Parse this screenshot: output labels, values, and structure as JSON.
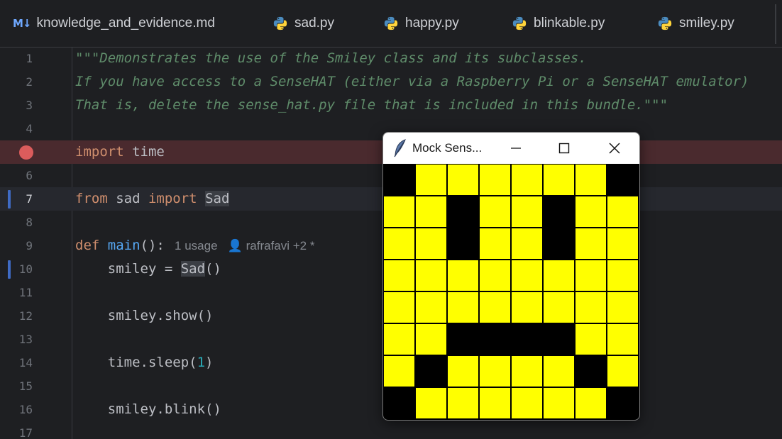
{
  "tabs": [
    {
      "label": "knowledge_and_evidence.md",
      "type": "md",
      "icon": "markdown-icon",
      "icon_text": "M↓"
    },
    {
      "label": "sad.py",
      "type": "py",
      "icon": "python-icon"
    },
    {
      "label": "happy.py",
      "type": "py",
      "icon": "python-icon"
    },
    {
      "label": "blinkable.py",
      "type": "py",
      "icon": "python-icon"
    },
    {
      "label": "smiley.py",
      "type": "py",
      "icon": "python-icon"
    }
  ],
  "editor": {
    "lines": [
      {
        "n": "1",
        "tokens": [
          {
            "t": "\"\"\"Demonstrates the use of the Smiley class and its subclasses.",
            "c": "doc"
          }
        ]
      },
      {
        "n": "2",
        "tokens": [
          {
            "t": "If you have access to a SenseHAT (either via a Raspberry Pi or a SenseHAT emulator)",
            "c": "doc"
          }
        ]
      },
      {
        "n": "3",
        "tokens": [
          {
            "t": "That is, delete the sense_hat.py file that is included in this bundle.\"\"\"",
            "c": "doc"
          }
        ]
      },
      {
        "n": "4",
        "tokens": []
      },
      {
        "n": "",
        "breakpoint": true,
        "tokens": [
          {
            "t": "import",
            "c": "kw"
          },
          {
            "t": " time",
            "c": ""
          }
        ]
      },
      {
        "n": "6",
        "tokens": []
      },
      {
        "n": "7",
        "active": true,
        "changed": true,
        "tokens": [
          {
            "t": "from",
            "c": "kw"
          },
          {
            "t": " sad ",
            "c": ""
          },
          {
            "t": "import",
            "c": "kw"
          },
          {
            "t": " ",
            "c": ""
          },
          {
            "t": "Sad",
            "c": "ref-hl"
          }
        ]
      },
      {
        "n": "8",
        "tokens": []
      },
      {
        "n": "9",
        "tokens": [
          {
            "t": "def",
            "c": "kw"
          },
          {
            "t": " ",
            "c": ""
          },
          {
            "t": "main",
            "c": "fn"
          },
          {
            "t": "():",
            "c": ""
          },
          {
            "t": "   1 usage   👤 rafrafavi +2 *",
            "c": "hint"
          }
        ]
      },
      {
        "n": "10",
        "changed": true,
        "tokens": [
          {
            "t": "    smiley = ",
            "c": ""
          },
          {
            "t": "Sad",
            "c": "ref-hl"
          },
          {
            "t": "()",
            "c": ""
          }
        ]
      },
      {
        "n": "11",
        "tokens": []
      },
      {
        "n": "12",
        "tokens": [
          {
            "t": "    smiley.show()",
            "c": ""
          }
        ]
      },
      {
        "n": "13",
        "tokens": []
      },
      {
        "n": "14",
        "tokens": [
          {
            "t": "    time.sleep(",
            "c": ""
          },
          {
            "t": "1",
            "c": "num"
          },
          {
            "t": ")",
            "c": ""
          }
        ]
      },
      {
        "n": "15",
        "tokens": []
      },
      {
        "n": "16",
        "tokens": [
          {
            "t": "    smiley.blink()",
            "c": ""
          }
        ]
      },
      {
        "n": "17",
        "tokens": []
      }
    ]
  },
  "window": {
    "title": "Mock Sens...",
    "app_icon": "feather-icon",
    "buttons": {
      "minimize": "minimize-icon",
      "maximize": "maximize-icon",
      "close": "close-icon"
    },
    "colors": {
      "Y": "#ffff00",
      "B": "#000000"
    },
    "pixels": [
      "BYYYYYYB",
      "YYBYYBYY",
      "YYBYYBYY",
      "YYYYYYYY",
      "YYYYYYYY",
      "YYBBBBYY",
      "YBYYYYBY",
      "BYYYYYYB"
    ]
  }
}
